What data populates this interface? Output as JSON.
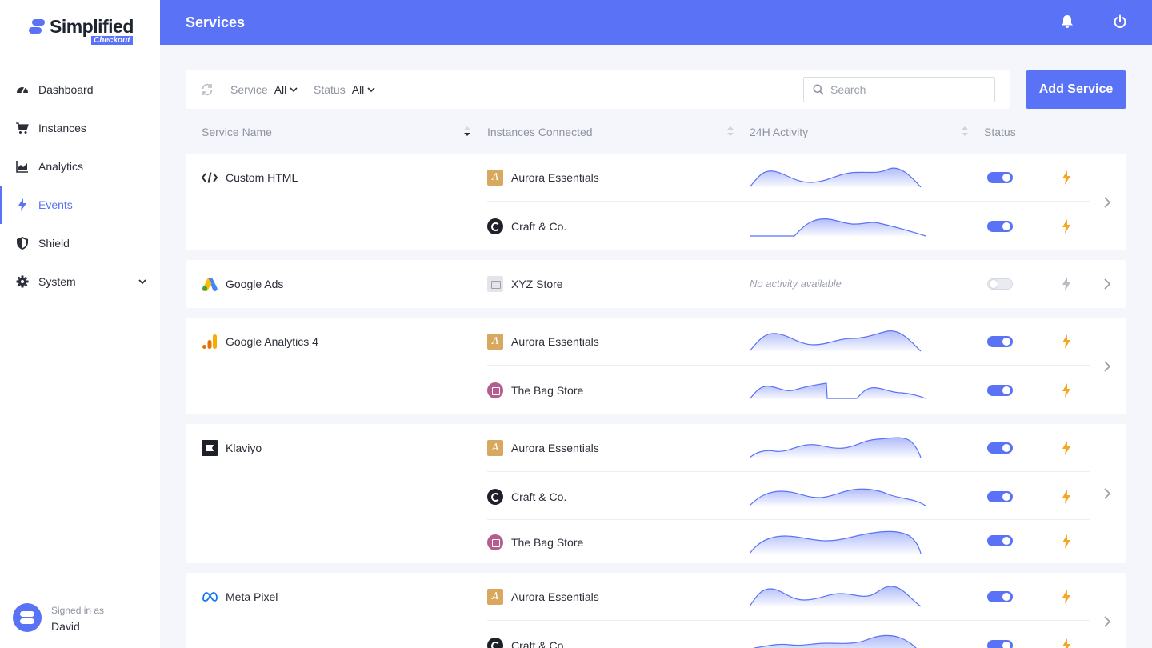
{
  "brand": {
    "name": "Simplified",
    "sub": "Checkout"
  },
  "header": {
    "title": "Services"
  },
  "sidebar": {
    "items": [
      {
        "label": "Dashboard",
        "icon": "gauge-icon"
      },
      {
        "label": "Instances",
        "icon": "cart-icon"
      },
      {
        "label": "Analytics",
        "icon": "area-chart-icon"
      },
      {
        "label": "Events",
        "icon": "bolt-icon",
        "active": true
      },
      {
        "label": "Shield",
        "icon": "shield-icon"
      },
      {
        "label": "System",
        "icon": "gear-icon",
        "expandable": true
      }
    ],
    "signed_in_label": "Signed in as",
    "user_name": "David"
  },
  "filters": {
    "service_label": "Service",
    "service_value": "All",
    "status_label": "Status",
    "status_value": "All",
    "search_placeholder": "Search"
  },
  "add_service_label": "Add Service",
  "columns": {
    "service_name": "Service Name",
    "instances_connected": "Instances Connected",
    "activity": "24H Activity",
    "status": "Status"
  },
  "services": [
    {
      "name": "Custom HTML",
      "icon": "code-icon",
      "instances": [
        {
          "name": "Aurora Essentials",
          "icon": "aurora",
          "enabled": true
        },
        {
          "name": "Craft & Co.",
          "icon": "craft",
          "enabled": true
        }
      ]
    },
    {
      "name": "Google Ads",
      "icon": "google-ads-icon",
      "instances": [
        {
          "name": "XYZ Store",
          "icon": "xyz",
          "enabled": false,
          "no_activity": "No activity available"
        }
      ]
    },
    {
      "name": "Google Analytics 4",
      "icon": "google-analytics-icon",
      "instances": [
        {
          "name": "Aurora Essentials",
          "icon": "aurora",
          "enabled": true
        },
        {
          "name": "The Bag Store",
          "icon": "bag",
          "enabled": true
        }
      ]
    },
    {
      "name": "Klaviyo",
      "icon": "klaviyo-icon",
      "instances": [
        {
          "name": "Aurora Essentials",
          "icon": "aurora",
          "enabled": true
        },
        {
          "name": "Craft & Co.",
          "icon": "craft",
          "enabled": true
        },
        {
          "name": "The Bag Store",
          "icon": "bag",
          "enabled": true
        }
      ]
    },
    {
      "name": "Meta Pixel",
      "icon": "meta-icon",
      "instances": [
        {
          "name": "Aurora Essentials",
          "icon": "aurora",
          "enabled": true
        },
        {
          "name": "Craft & Co.",
          "icon": "craft",
          "enabled": true
        }
      ]
    }
  ],
  "colors": {
    "accent": "#5a72f5",
    "bolt_active": "#f5a623",
    "bolt_inactive": "#b7bbc4"
  }
}
